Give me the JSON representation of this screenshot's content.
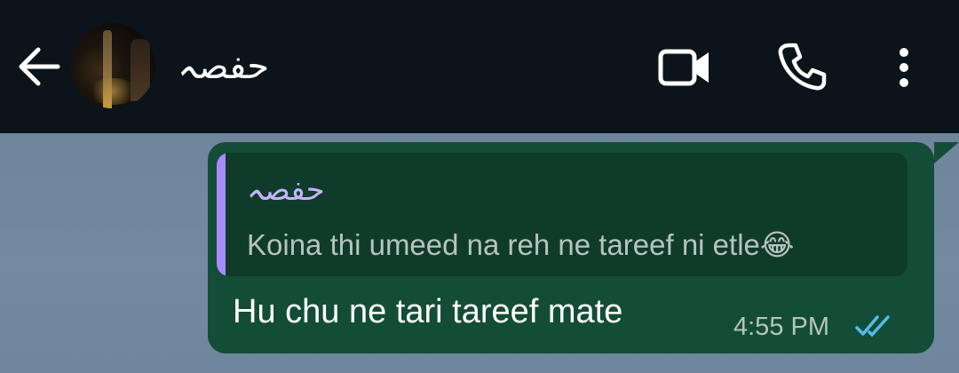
{
  "header": {
    "contact_name": "حفصہ",
    "icons": {
      "back": "arrow-left-icon",
      "video": "video-camera-icon",
      "call": "phone-icon",
      "menu": "more-vertical-icon"
    }
  },
  "message": {
    "reply": {
      "sender": "حفصہ",
      "text": "Koina thi umeed na reh ne tareef ni etle😂"
    },
    "text": "Hu chu ne tari tareef mate",
    "time": "4:55 PM",
    "status_icon": "double-check-icon"
  },
  "colors": {
    "header_bg": "#0b141a",
    "bubble_bg": "#144d37",
    "quote_bg": "#0f3b2a",
    "quote_accent": "#a78bfa",
    "read_tick": "#53bdeb"
  }
}
